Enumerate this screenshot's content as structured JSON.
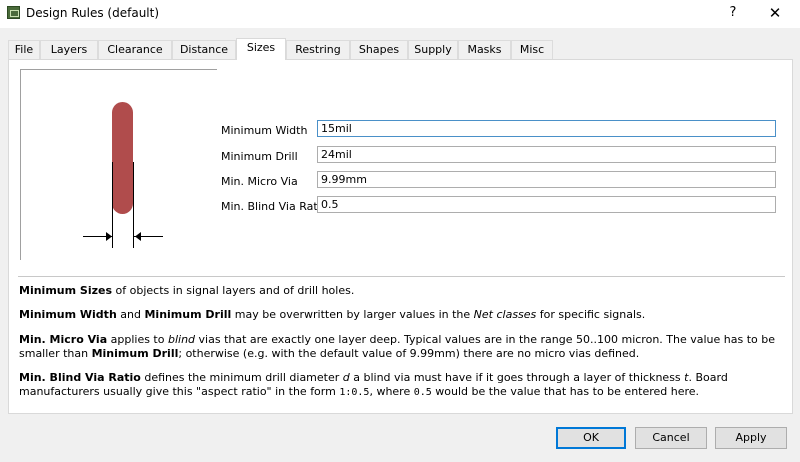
{
  "window": {
    "title": "Design Rules (default)",
    "help": "?",
    "close": "✕"
  },
  "tabs": [
    {
      "label": "File"
    },
    {
      "label": "Layers"
    },
    {
      "label": "Clearance"
    },
    {
      "label": "Distance"
    },
    {
      "label": "Sizes",
      "active": true
    },
    {
      "label": "Restring"
    },
    {
      "label": "Shapes"
    },
    {
      "label": "Supply"
    },
    {
      "label": "Masks"
    },
    {
      "label": "Misc"
    }
  ],
  "fields": {
    "min_width": {
      "label": "Minimum Width",
      "value": "15mil"
    },
    "min_drill": {
      "label": "Minimum Drill",
      "value": "24mil"
    },
    "min_micro_via": {
      "label": "Min. Micro Via",
      "value": "9.99mm"
    },
    "min_blind_via_ratio": {
      "label": "Min. Blind Via Ratio",
      "value": "0.5"
    }
  },
  "description": {
    "p1": {
      "b1": "Minimum Sizes",
      "t1": " of objects in signal layers and of drill holes."
    },
    "p2": {
      "b1": "Minimum Width",
      "t1": " and ",
      "b2": "Minimum Drill",
      "t2": " may be overwritten by larger values in the ",
      "i1": "Net classes",
      "t3": " for specific signals."
    },
    "p3": {
      "b1": "Min. Micro Via",
      "t1": " applies to ",
      "i1": "blind",
      "t2": " vias that are exactly one layer deep. Typical values are in the range 50..100 micron. The value has to be smaller than ",
      "b2": "Minimum Drill",
      "t3": "; otherwise (e.g. with the default value of 9.99mm) there are no micro vias defined."
    },
    "p4": {
      "b1": "Min. Blind Via Ratio",
      "t1": " defines the minimum drill diameter ",
      "i1": "d",
      "t2": " a blind via must have if it goes through a layer of thickness ",
      "i2": "t",
      "t3": ". Board manufacturers usually give this \"aspect ratio\" in the form ",
      "m1": "1:0.5",
      "t4": ", where ",
      "m2": "0.5",
      "t5": " would be the value that has to be entered here."
    }
  },
  "buttons": {
    "ok": "OK",
    "cancel": "Cancel",
    "apply": "Apply"
  },
  "colors": {
    "track": "#b04c4c",
    "focus": "#0078d7"
  }
}
